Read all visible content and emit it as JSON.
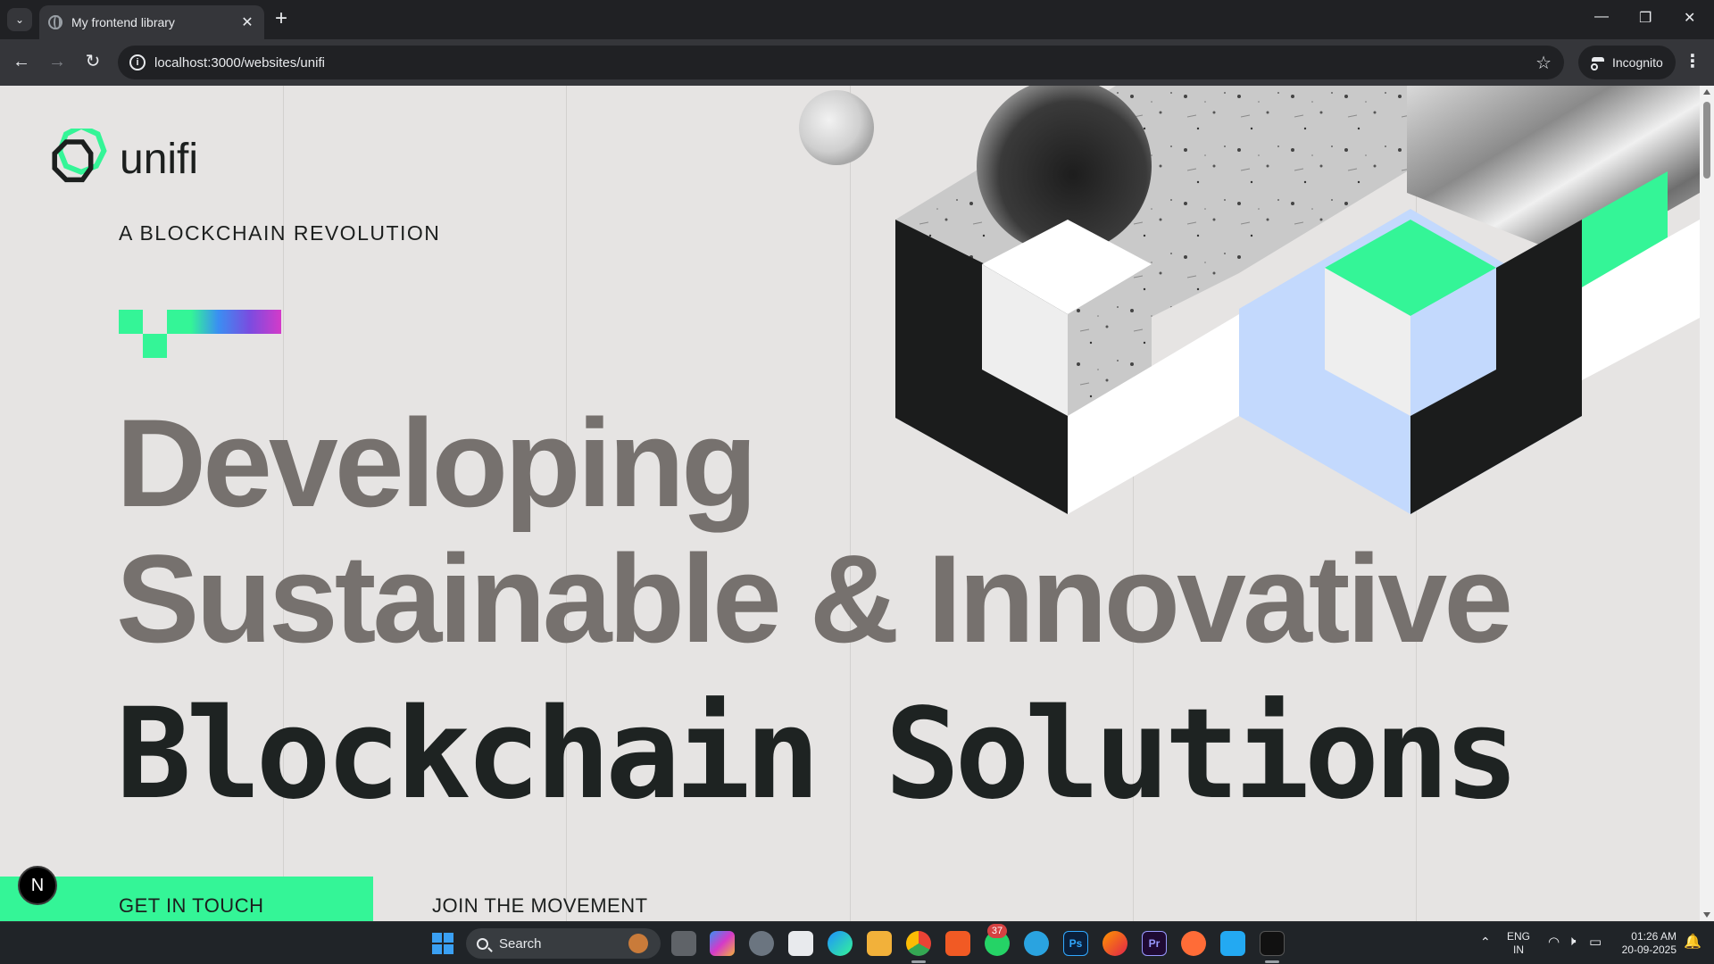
{
  "browser": {
    "tab_title": "My frontend library",
    "url": "localhost:3000/websites/unifi",
    "incognito_label": "Incognito",
    "new_tab_symbol": "+",
    "tab_close_symbol": "✕",
    "tab_search_symbol": "⌄",
    "window_controls": {
      "minimize": "—",
      "restore": "❐",
      "close": "✕"
    }
  },
  "page": {
    "logo_text": "unifi",
    "eyebrow": "A BLOCKCHAIN REVOLUTION",
    "headline_line1": "Developing",
    "headline_line2": "Sustainable & Innovative",
    "headline_line3": "Blockchain Solutions",
    "cta_primary": "GET IN TOUCH",
    "cta_secondary": "JOIN THE MOVEMENT",
    "dev_badge": "N",
    "colors": {
      "background": "#e6e4e3",
      "accent_green": "#34f597",
      "light_blue": "#c3d9fd",
      "ink": "#1c1f1e",
      "muted_text": "#76716e"
    }
  },
  "taskbar": {
    "search_placeholder": "Search",
    "notification_count": "37",
    "language_line1": "ENG",
    "language_line2": "IN",
    "time": "01:26 AM",
    "date": "20-09-2025",
    "apps": [
      {
        "name": "task-view-icon",
        "label": ""
      },
      {
        "name": "copilot-icon",
        "label": ""
      },
      {
        "name": "settings-icon",
        "label": ""
      },
      {
        "name": "store-icon",
        "label": ""
      },
      {
        "name": "edge-icon",
        "label": ""
      },
      {
        "name": "file-explorer-icon",
        "label": ""
      },
      {
        "name": "chrome-icon",
        "label": ""
      },
      {
        "name": "brave-icon",
        "label": ""
      },
      {
        "name": "whatsapp-icon",
        "label": ""
      },
      {
        "name": "telegram-icon",
        "label": ""
      },
      {
        "name": "photoshop-icon",
        "label": "Ps"
      },
      {
        "name": "firefox-icon",
        "label": ""
      },
      {
        "name": "premiere-icon",
        "label": "Pr"
      },
      {
        "name": "postman-icon",
        "label": ""
      },
      {
        "name": "vscode-icon",
        "label": ""
      },
      {
        "name": "cursor-app-icon",
        "label": ""
      }
    ]
  }
}
